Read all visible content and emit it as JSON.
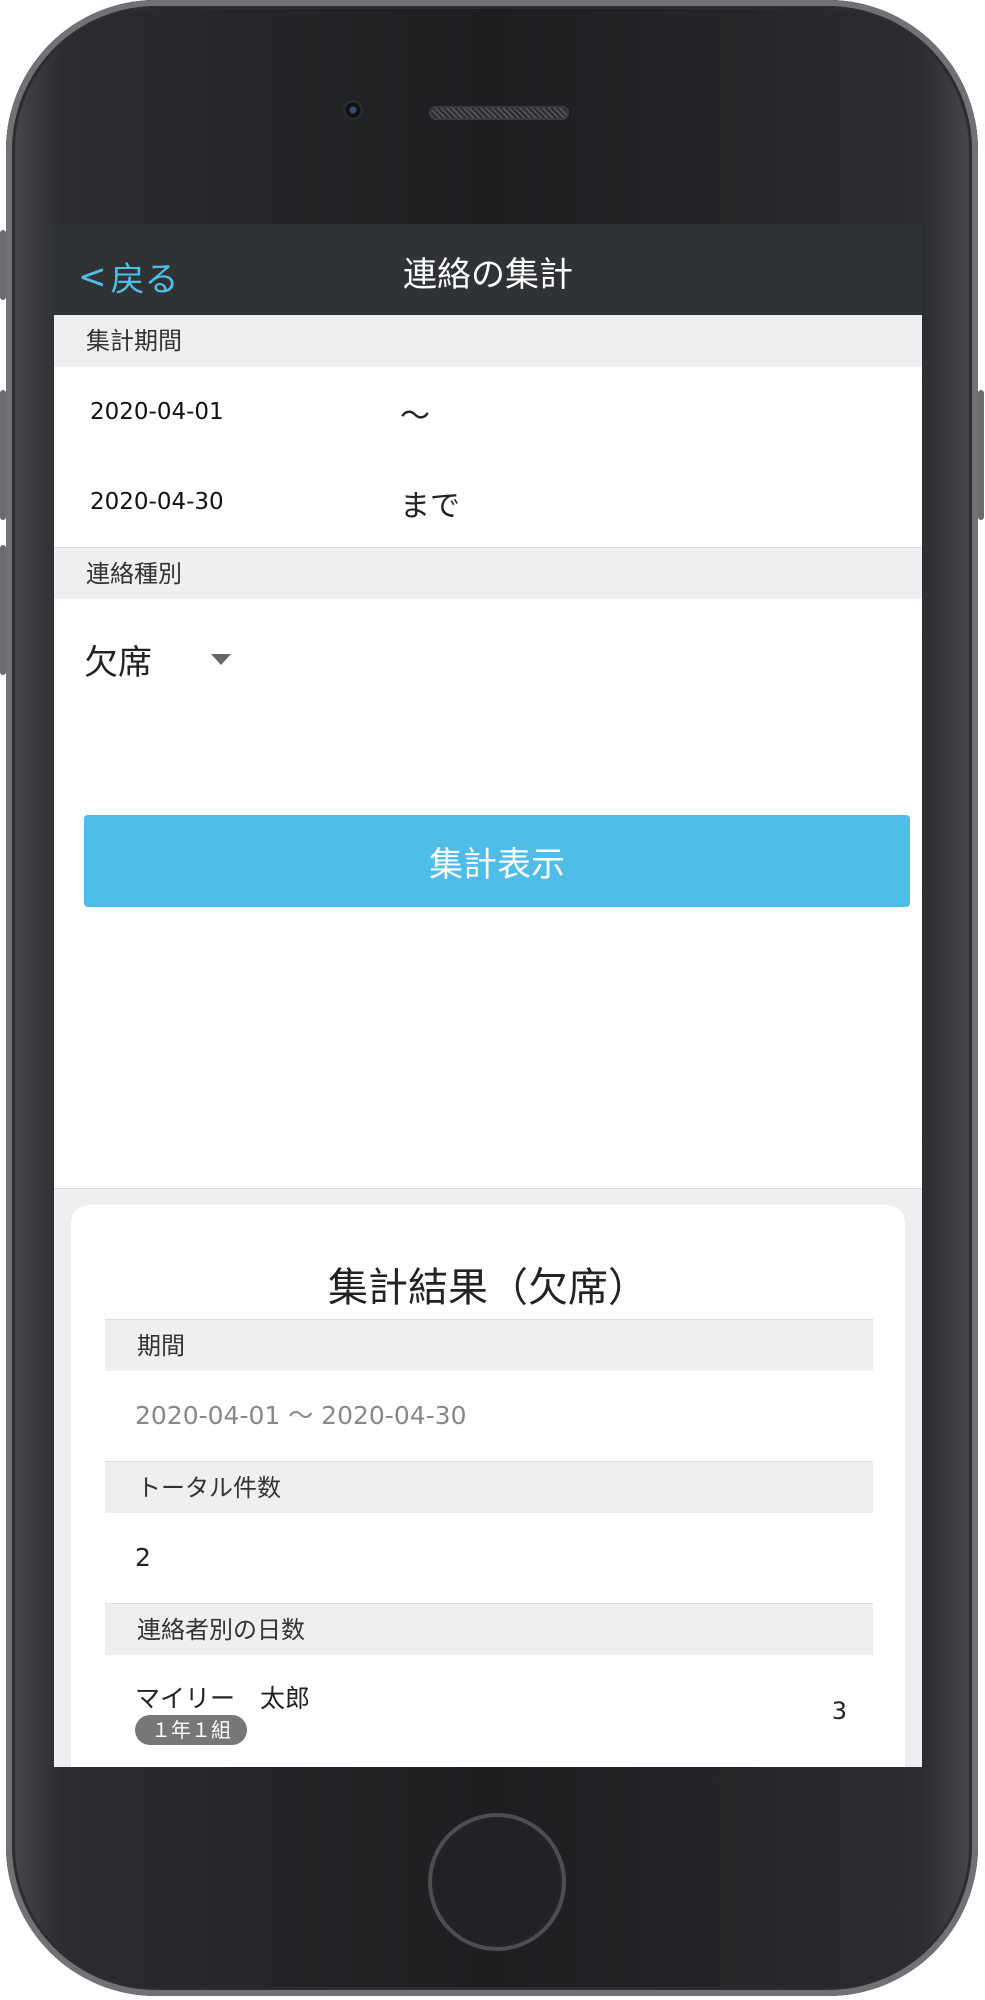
{
  "nav": {
    "back_label": "戻る",
    "title": "連絡の集計"
  },
  "period": {
    "header": "集計期間",
    "start_date": "2020-04-01",
    "start_suffix": "〜",
    "end_date": "2020-04-30",
    "end_suffix": "まで"
  },
  "type": {
    "header": "連絡種別",
    "selected": "欠席"
  },
  "action": {
    "button_label": "集計表示"
  },
  "result": {
    "title": "集計結果（欠席）",
    "period_header": "期間",
    "period_value": "2020-04-01 〜 2020-04-30",
    "total_header": "トータル件数",
    "total_value": "2",
    "by_contact_header": "連絡者別の日数",
    "contacts": [
      {
        "name": "マイリー　太郎",
        "class": "１年１組",
        "days": "3"
      }
    ]
  }
}
